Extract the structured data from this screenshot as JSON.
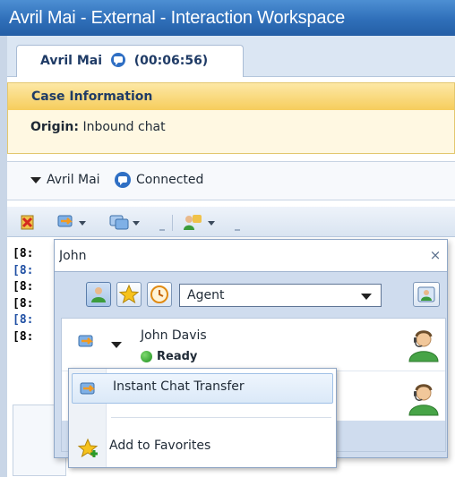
{
  "window": {
    "title": "Avril Mai - External - Interaction Workspace"
  },
  "tab": {
    "label": "Avril Mai",
    "timer": "(00:06:56)"
  },
  "case": {
    "header": "Case Information",
    "origin_label": "Origin:",
    "origin_value": "Inbound chat"
  },
  "party": {
    "name": "Avril Mai",
    "status": "Connected"
  },
  "transcript": {
    "lines": [
      {
        "text": "[8:",
        "color": "#000000"
      },
      {
        "text": "[8:",
        "color": "#1f4fa3"
      },
      {
        "text": "[8:",
        "color": "#000000"
      },
      {
        "text": "[8:",
        "color": "#000000"
      },
      {
        "text": "[8:",
        "color": "#1f4fa3"
      },
      {
        "text": "[8:",
        "color": "#000000"
      }
    ]
  },
  "popup": {
    "search_value": "John",
    "clear_glyph": "×",
    "filter_value": "Agent",
    "agents": [
      {
        "name": "John Davis",
        "status": "Ready"
      }
    ],
    "context_menu": {
      "item1": "Instant Chat Transfer",
      "item2": "Add to Favorites"
    }
  },
  "colors": {
    "title_bar": "#2f6fb9",
    "case_header": "#f6cd5c",
    "status_ready": "#1e8f1e",
    "selection": "#dbe9f8"
  }
}
